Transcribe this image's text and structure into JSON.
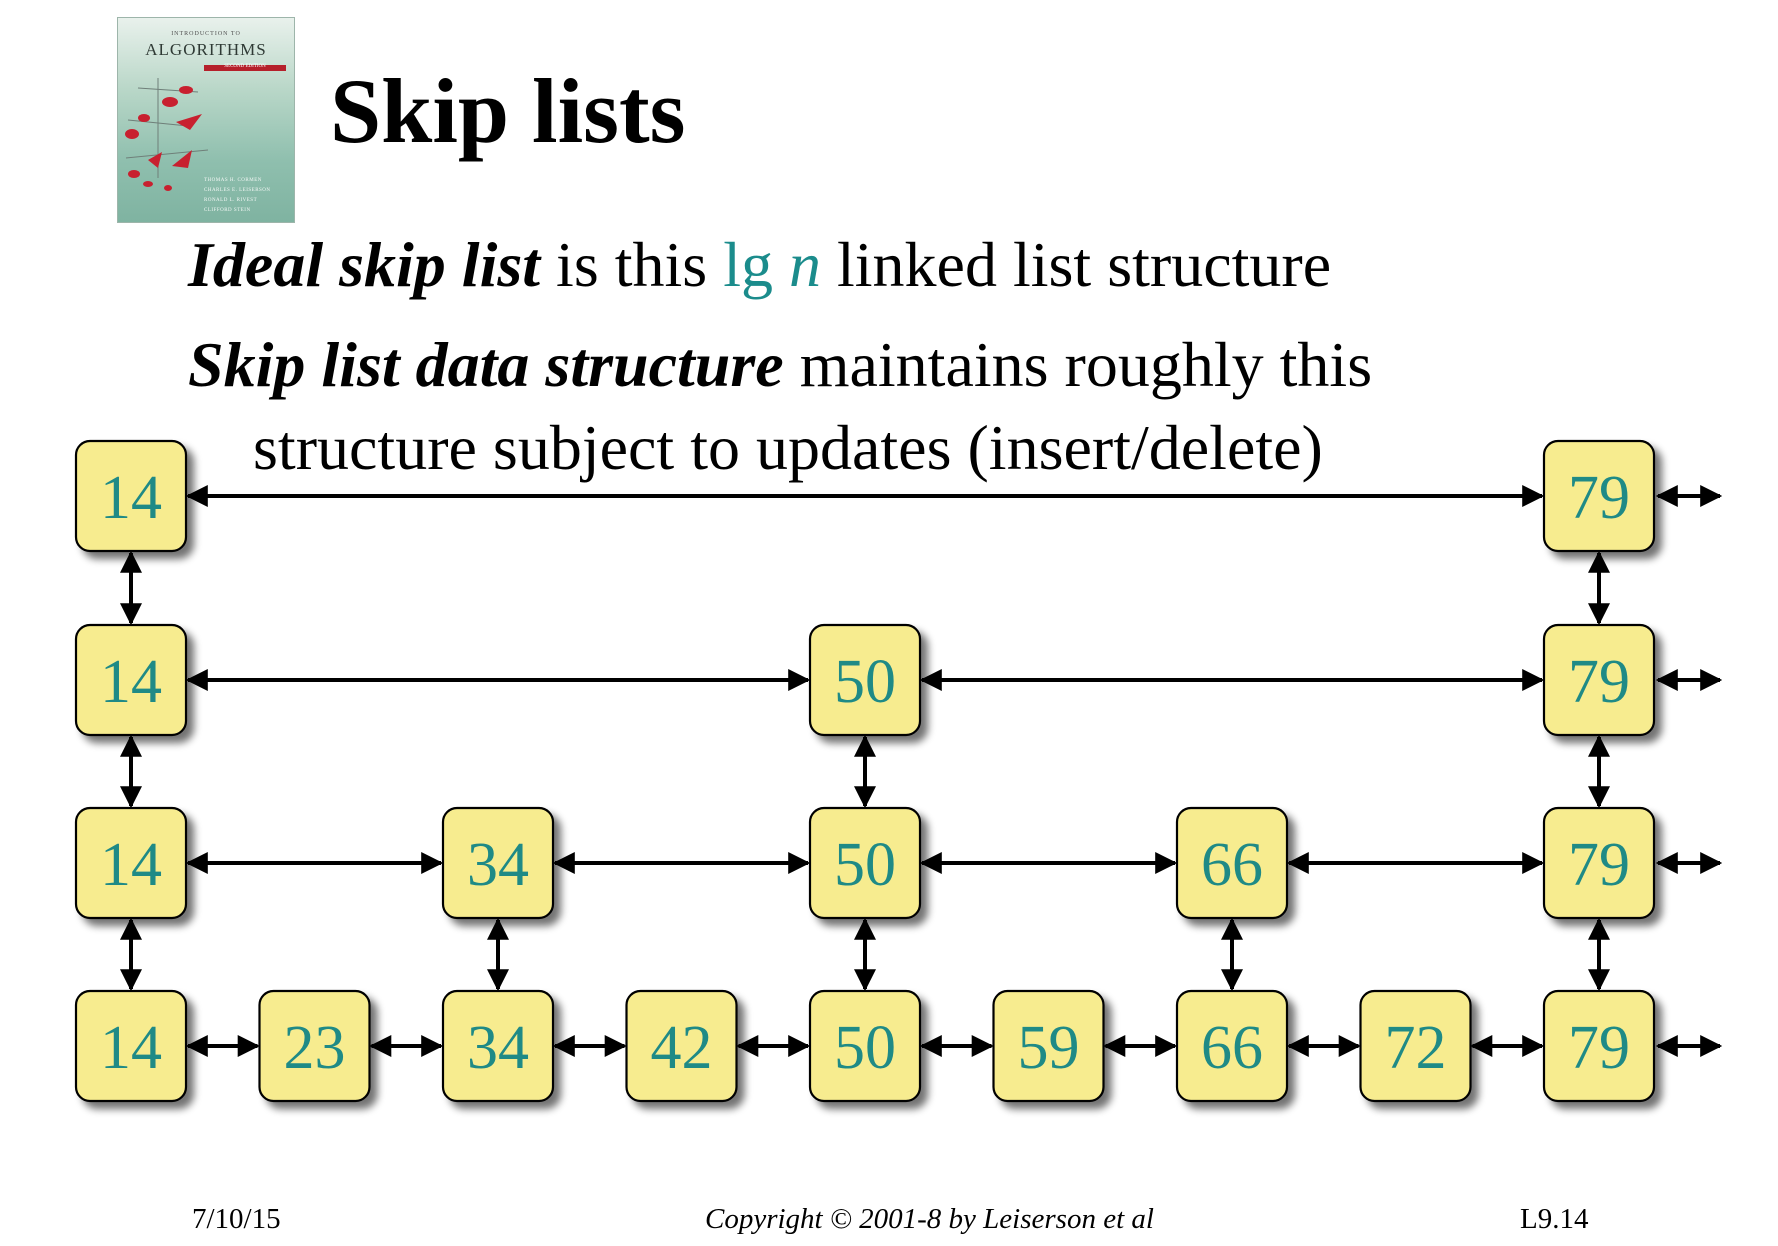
{
  "cover": {
    "subtitle": "INTRODUCTION TO",
    "title": "ALGORITHMS",
    "edition": "SECOND EDITION",
    "authors": [
      "THOMAS H. CORMEN",
      "CHARLES E. LEISERSON",
      "RONALD L. RIVEST",
      "CLIFFORD STEIN"
    ]
  },
  "slide": {
    "title": "Skip lists",
    "line1": {
      "term": "Ideal skip list",
      "mid": " is this ",
      "lg": "lg ",
      "n": "n",
      "end": " linked list structure"
    },
    "line2": {
      "term": "Skip list data structure",
      "end": " maintains roughly this"
    },
    "line3": "structure subject to updates (insert/delete)"
  },
  "skiplist": {
    "levels": [
      [
        "14",
        "79"
      ],
      [
        "14",
        "50",
        "79"
      ],
      [
        "14",
        "34",
        "50",
        "66",
        "79"
      ],
      [
        "14",
        "23",
        "34",
        "42",
        "50",
        "59",
        "66",
        "72",
        "79"
      ]
    ],
    "columns": [
      "14",
      "23",
      "34",
      "42",
      "50",
      "59",
      "66",
      "72",
      "79"
    ],
    "node_fill": "#f7ec8f",
    "text_color": "#1f8a86"
  },
  "footer": {
    "date": "7/10/15",
    "copyright": "Copyright © 2001-8 by  Leiserson et al",
    "page": "L9.14"
  }
}
